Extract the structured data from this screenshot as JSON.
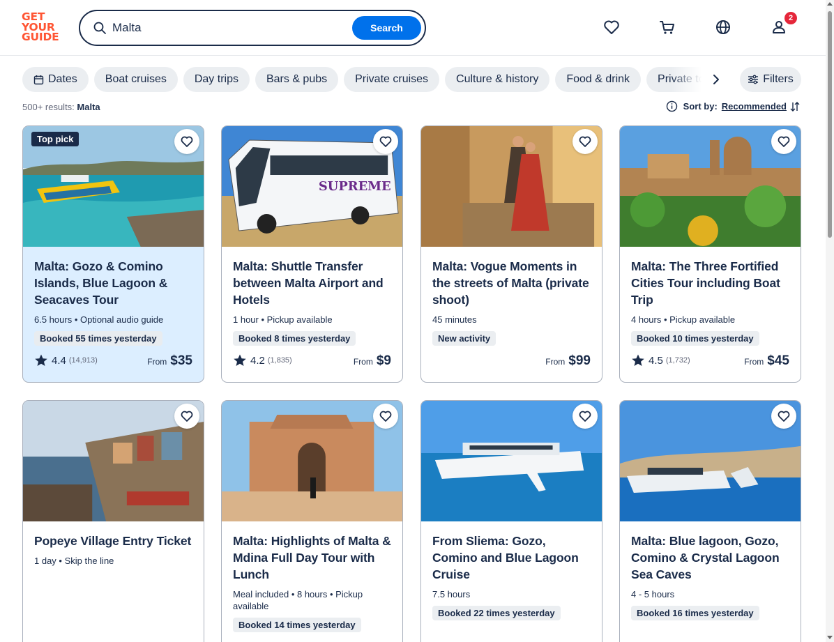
{
  "header": {
    "logo_lines": [
      "GET",
      "YOUR",
      "GUIDE"
    ],
    "search_value": "Malta",
    "search_button": "Search",
    "icons": [
      "heart-icon",
      "cart-icon",
      "globe-icon",
      "profile-icon"
    ],
    "profile_badge": "2"
  },
  "chips": [
    "Dates",
    "Boat cruises",
    "Day trips",
    "Bars & pubs",
    "Private cruises",
    "Culture & history",
    "Food & drink",
    "Private tours"
  ],
  "filters_label": "Filters",
  "results": {
    "count_text": "500+ results:",
    "query": "Malta"
  },
  "sort": {
    "label": "Sort by:",
    "value": "Recommended"
  },
  "colors": {
    "accent": "#0071eb",
    "brand": "#ff5533",
    "ink": "#1a2b49",
    "badge": "#e5263a"
  },
  "cards": [
    {
      "badge": "Top pick",
      "title": "Malta: Gozo & Comino Islands, Blue Lagoon & Seacaves Tour",
      "meta": "6.5 hours • Optional audio guide",
      "booked": "Booked 55 times yesterday",
      "rating": "4.4",
      "reviews": "(14,913)",
      "from": "From",
      "price": "$35"
    },
    {
      "title": "Malta: Shuttle Transfer between Malta Airport and Hotels",
      "meta": "1 hour • Pickup available",
      "booked": "Booked 8 times yesterday",
      "rating": "4.2",
      "reviews": "(1,835)",
      "from": "From",
      "price": "$9"
    },
    {
      "title": "Malta: Vogue Moments in the streets of Malta (private shoot)",
      "meta": "45 minutes",
      "booked": "New activity",
      "from": "From",
      "price": "$99"
    },
    {
      "title": "Malta: The Three Fortified Cities Tour including Boat Trip",
      "meta": "4 hours • Pickup available",
      "booked": "Booked 10 times yesterday",
      "rating": "4.5",
      "reviews": "(1,732)",
      "from": "From",
      "price": "$45"
    },
    {
      "title": "Popeye Village Entry Ticket",
      "meta": "1 day • Skip the line"
    },
    {
      "title": "Malta: Highlights of Malta & Mdina Full Day Tour with Lunch",
      "meta": "Meal included • 8 hours • Pickup available",
      "booked": "Booked 14 times yesterday"
    },
    {
      "title": "From Sliema: Gozo, Comino and Blue Lagoon Cruise",
      "meta": "7.5 hours",
      "booked": "Booked 22 times yesterday"
    },
    {
      "title": "Malta: Blue lagoon, Gozo, Comino & Crystal Lagoon Sea Caves",
      "meta": "4 - 5 hours",
      "booked": "Booked 16 times yesterday"
    }
  ]
}
